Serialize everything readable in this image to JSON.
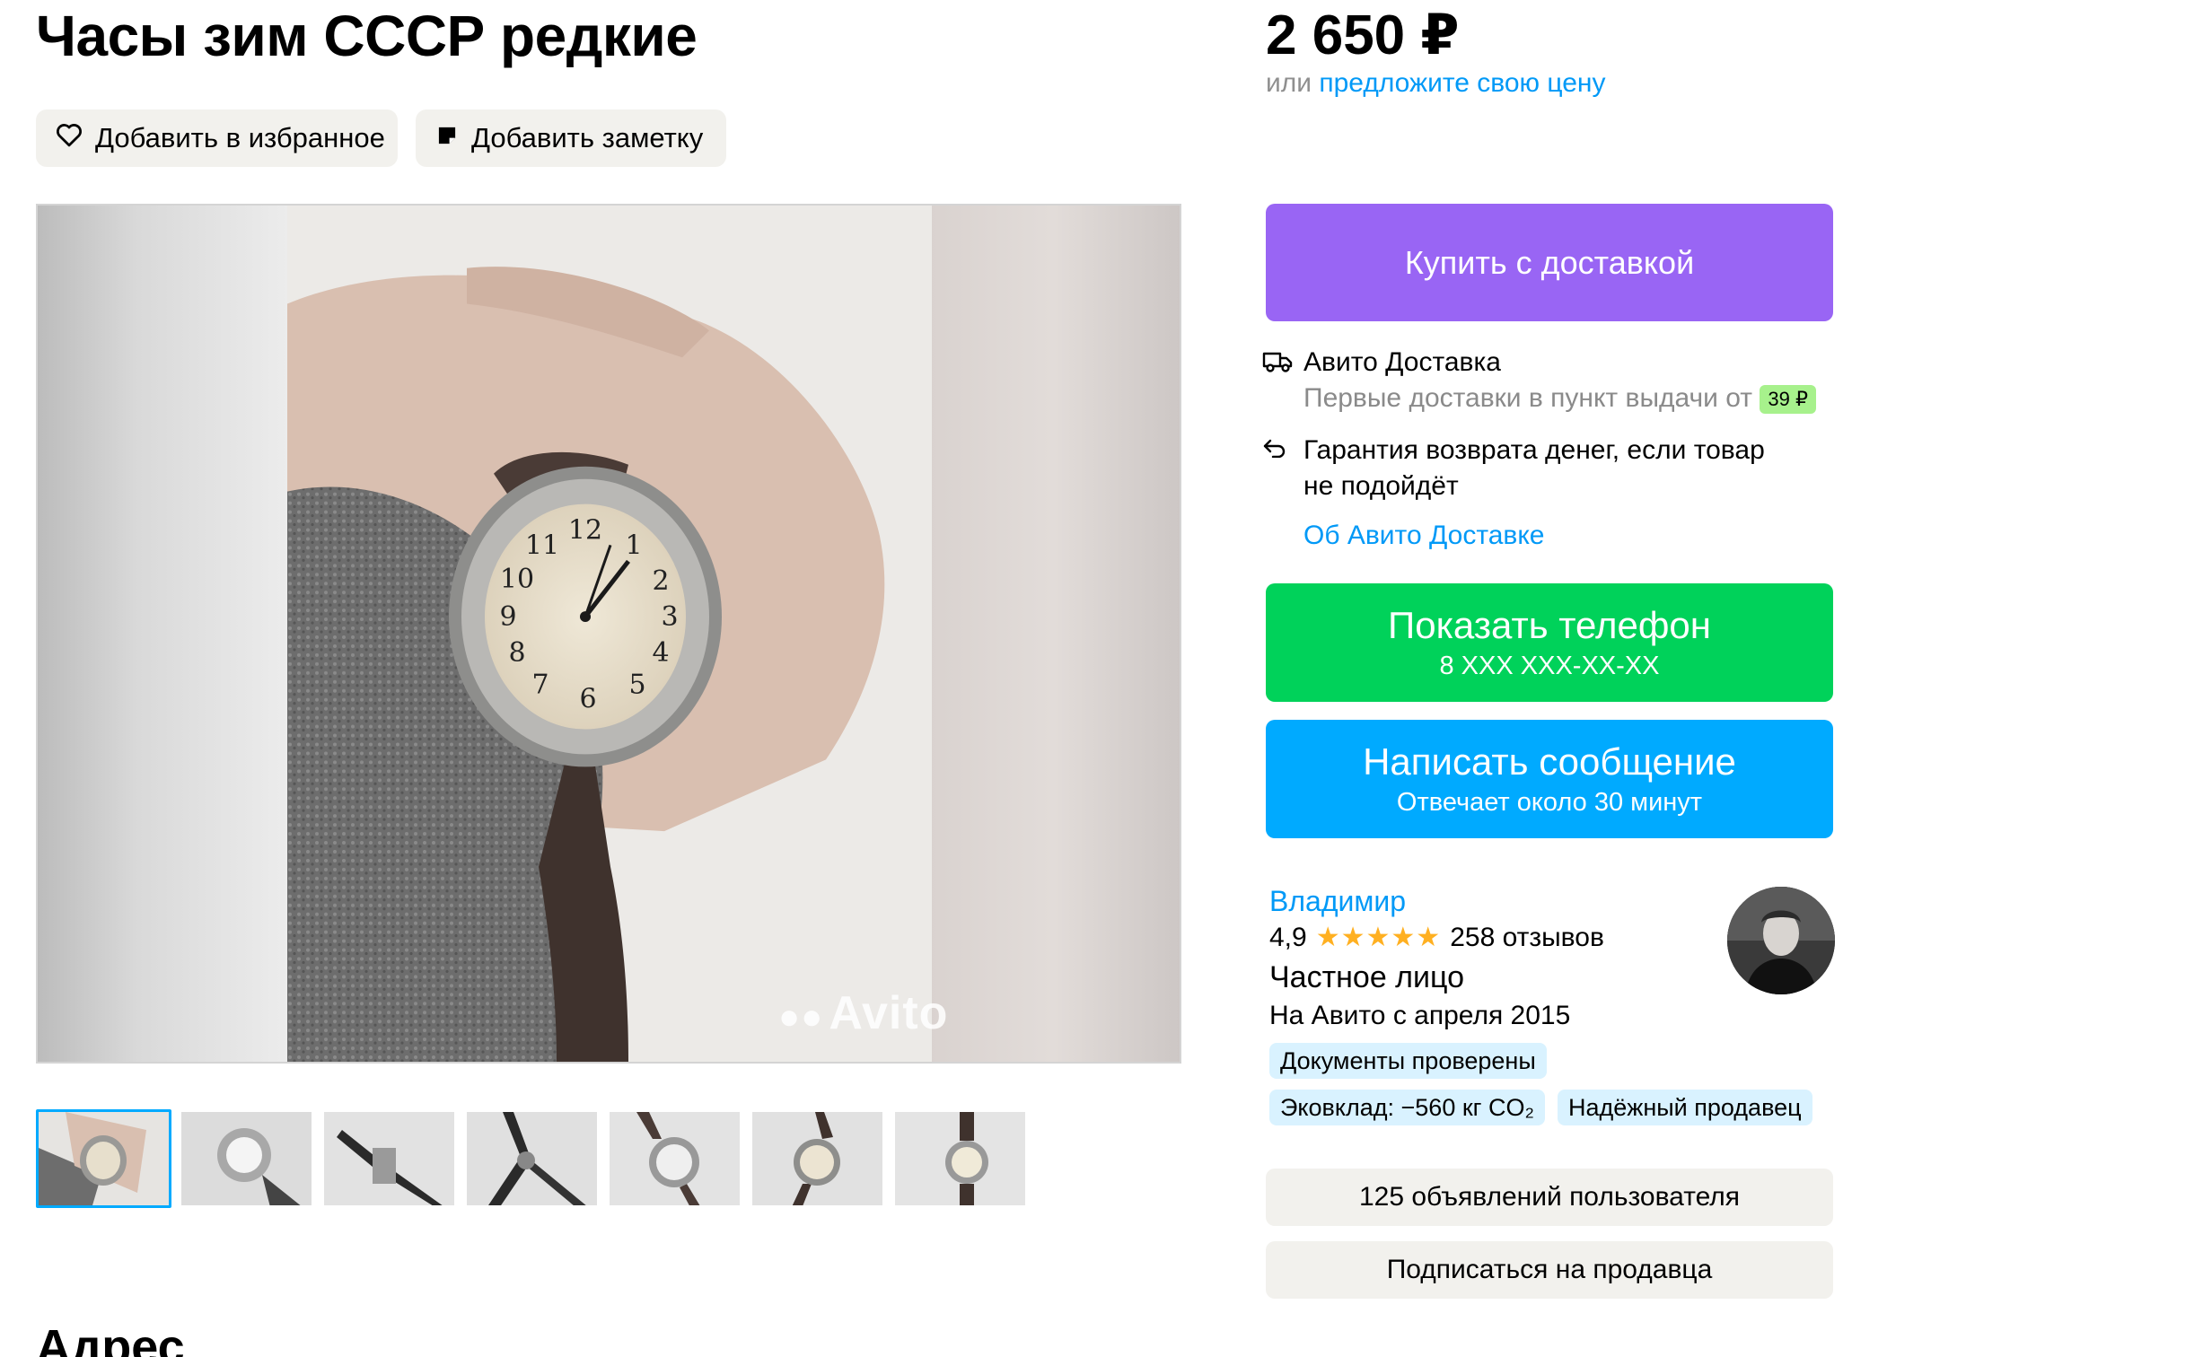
{
  "listing": {
    "title": "Часы зим СССР редкие",
    "price": "2 650 ₽",
    "offer_prefix": "или",
    "offer_link": "предложите свою цену"
  },
  "actions": {
    "favorite_label": "Добавить в избранное",
    "note_label": "Добавить заметку"
  },
  "gallery": {
    "watermark": "Avito",
    "thumbnail_count": 7,
    "active_index": 0
  },
  "buy": {
    "label": "Купить с доставкой"
  },
  "delivery": {
    "title": "Авито Доставка",
    "subtitle": "Первые доставки в пункт выдачи от",
    "price_badge": "39 ₽",
    "guarantee_line1": "Гарантия возврата денег, если товар",
    "guarantee_line2": "не подойдёт",
    "about_link": "Об Авито Доставке"
  },
  "phone_button": {
    "label": "Показать телефон",
    "number": "8 XXX XXX-XX-XX"
  },
  "message_button": {
    "label": "Написать сообщение",
    "sub": "Отвечает около 30 минут"
  },
  "seller": {
    "name": "Владимир",
    "rating": "4,9",
    "stars": "★★★★★",
    "reviews": "258 отзывов",
    "type": "Частное лицо",
    "since": "На Авито с апреля 2015",
    "tags": [
      "Документы проверены",
      "Эковклад: −560 кг CO₂",
      "Надёжный продавец"
    ]
  },
  "seller_actions": {
    "ads_label": "125 объявлений пользователя",
    "subscribe_label": "Подписаться на продавца"
  },
  "sections": {
    "address_heading": "Адрес"
  },
  "colors": {
    "buy": "#9965f4",
    "phone": "#00d25a",
    "message": "#00aaff",
    "link": "#0099f7",
    "star": "#ffb021",
    "tag_bg": "#d9f2ff",
    "badge_green": "#a7f18c"
  }
}
